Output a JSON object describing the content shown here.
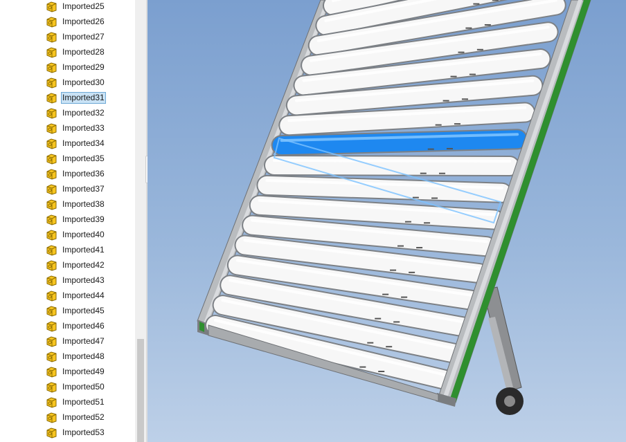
{
  "feature_tree": {
    "items": [
      {
        "label": "Imported25",
        "selected": false
      },
      {
        "label": "Imported26",
        "selected": false
      },
      {
        "label": "Imported27",
        "selected": false
      },
      {
        "label": "Imported28",
        "selected": false
      },
      {
        "label": "Imported29",
        "selected": false
      },
      {
        "label": "Imported30",
        "selected": false
      },
      {
        "label": "Imported31",
        "selected": true
      },
      {
        "label": "Imported32",
        "selected": false
      },
      {
        "label": "Imported33",
        "selected": false
      },
      {
        "label": "Imported34",
        "selected": false
      },
      {
        "label": "Imported35",
        "selected": false
      },
      {
        "label": "Imported36",
        "selected": false
      },
      {
        "label": "Imported37",
        "selected": false
      },
      {
        "label": "Imported38",
        "selected": false
      },
      {
        "label": "Imported39",
        "selected": false
      },
      {
        "label": "Imported40",
        "selected": false
      },
      {
        "label": "Imported41",
        "selected": false
      },
      {
        "label": "Imported42",
        "selected": false
      },
      {
        "label": "Imported43",
        "selected": false
      },
      {
        "label": "Imported44",
        "selected": false
      },
      {
        "label": "Imported45",
        "selected": false
      },
      {
        "label": "Imported46",
        "selected": false
      },
      {
        "label": "Imported47",
        "selected": false
      },
      {
        "label": "Imported48",
        "selected": false
      },
      {
        "label": "Imported49",
        "selected": false
      },
      {
        "label": "Imported50",
        "selected": false
      },
      {
        "label": "Imported51",
        "selected": false
      },
      {
        "label": "Imported52",
        "selected": false
      },
      {
        "label": "Imported53",
        "selected": false
      }
    ],
    "item_icon": "part-icon"
  },
  "viewport": {
    "model": "roller-conveyor",
    "highlighted_roller_index": 7,
    "roller_count": 17,
    "colors": {
      "background_top": "#7b9fcf",
      "background_bottom": "#bdd0e8",
      "roller": "#f7f7f7",
      "selected_roller": "#1e88f0",
      "frame": "#b9bcbf",
      "frame_accent": "#2f8f2f"
    }
  }
}
